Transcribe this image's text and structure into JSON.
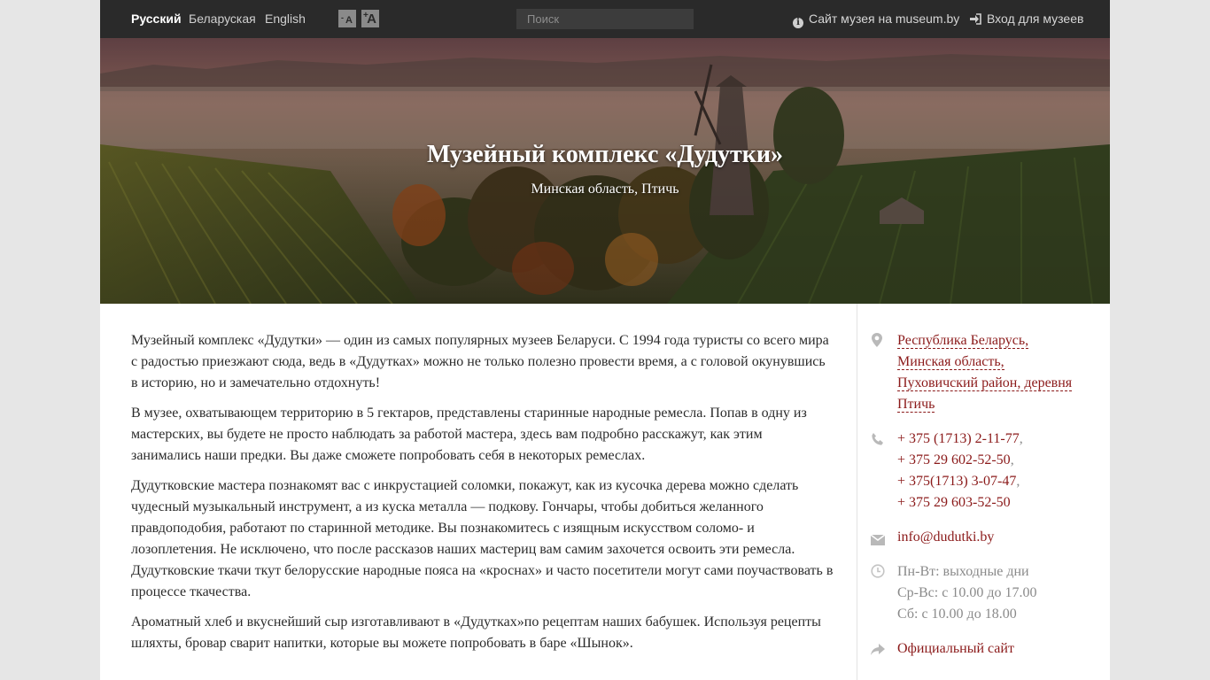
{
  "topbar": {
    "languages": [
      "Русский",
      "Беларуская",
      "English"
    ],
    "font_small_label": "A",
    "font_large_label": "A",
    "search_placeholder": "Поиск",
    "museum_site_link": "Сайт музея на museum.by",
    "login_link": "Вход для музеев"
  },
  "hero": {
    "title": "Музейный комплекс «Дудутки»",
    "subtitle": "Минская область, Птичь"
  },
  "content": {
    "paragraphs": [
      "Музейный комплекс «Дудутки» — один из самых популярных музеев Беларуси. С 1994 года туристы со всего мира с радостью приезжают сюда, ведь в «Дудутках» можно не только полезно провести время, а с головой окунувшись в историю, но и замечательно отдохнуть!",
      "В музее, охватывающем территорию в 5 гектаров, представлены старинные народные ремесла. Попав в одну из мастерских, вы будете не просто наблюдать за работой мастера, здесь вам подробно расскажут, как этим занимались наши предки. Вы даже сможете попробовать себя в некоторых ремеслах.",
      "Дудутковские мастера познакомят вас с инкрустацией соломки, покажут, как из кусочка дерева можно сделать чудесный музыкальный инструмент, а из куска металла — подкову. Гончары, чтобы добиться желанного правдоподобия, работают по старинной методике. Вы познакомитесь с изящным искусством соломо- и лозоплетения. Не исключено, что после рассказов наших мастериц вам самим захочется освоить эти ремесла. Дудутковские ткачи ткут белорусские народные пояса на «кроснах» и часто посетители могут сами поучаствовать в процессе ткачества.",
      "Ароматный хлеб и вкуснейший сыр изготавливают в «Дудутках»по рецептам наших бабушек. Используя рецепты шляхты,  бровар сварит напитки, которые вы можете попробовать в баре «Шынок»."
    ]
  },
  "sidebar": {
    "address_lines": [
      "Республика Беларусь,",
      "Минская область,",
      "Пуховичский район, деревня",
      "Птичь"
    ],
    "phones": [
      "+ 375 (1713) 2-11-77",
      "+ 375 29 602-52-50",
      "+ 375(1713) 3-07-47",
      "+ 375 29 603-52-50"
    ],
    "phone_separator": ",",
    "email": "info@dudutki.by",
    "hours": [
      "Пн-Вт: выходные дни",
      "Ср-Вс: с 10.00 до 17.00",
      "Сб: с 10.00 до 18.00"
    ],
    "official_site": "Официальный сайт"
  },
  "colors": {
    "link": "#8b1a1a",
    "topbar": "#2a2a2a"
  }
}
